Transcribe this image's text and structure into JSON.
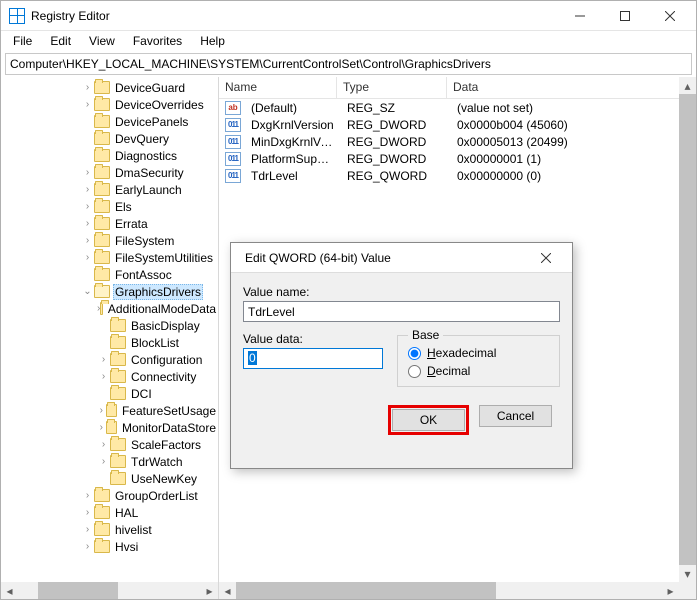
{
  "window": {
    "title": "Registry Editor"
  },
  "menu": {
    "file": "File",
    "edit": "Edit",
    "view": "View",
    "favorites": "Favorites",
    "help": "Help"
  },
  "address": "Computer\\HKEY_LOCAL_MACHINE\\SYSTEM\\CurrentControlSet\\Control\\GraphicsDrivers",
  "tree": [
    {
      "indent": 5,
      "tw": ">",
      "label": "DeviceGuard"
    },
    {
      "indent": 5,
      "tw": ">",
      "label": "DeviceOverrides"
    },
    {
      "indent": 5,
      "tw": "",
      "label": "DevicePanels"
    },
    {
      "indent": 5,
      "tw": "",
      "label": "DevQuery"
    },
    {
      "indent": 5,
      "tw": "",
      "label": "Diagnostics"
    },
    {
      "indent": 5,
      "tw": ">",
      "label": "DmaSecurity"
    },
    {
      "indent": 5,
      "tw": ">",
      "label": "EarlyLaunch"
    },
    {
      "indent": 5,
      "tw": ">",
      "label": "Els"
    },
    {
      "indent": 5,
      "tw": ">",
      "label": "Errata"
    },
    {
      "indent": 5,
      "tw": ">",
      "label": "FileSystem"
    },
    {
      "indent": 5,
      "tw": ">",
      "label": "FileSystemUtilities"
    },
    {
      "indent": 5,
      "tw": "",
      "label": "FontAssoc"
    },
    {
      "indent": 5,
      "tw": "v",
      "label": "GraphicsDrivers",
      "sel": true,
      "open": true
    },
    {
      "indent": 6,
      "tw": ">",
      "label": "AdditionalModeData"
    },
    {
      "indent": 6,
      "tw": "",
      "label": "BasicDisplay"
    },
    {
      "indent": 6,
      "tw": "",
      "label": "BlockList"
    },
    {
      "indent": 6,
      "tw": ">",
      "label": "Configuration"
    },
    {
      "indent": 6,
      "tw": ">",
      "label": "Connectivity"
    },
    {
      "indent": 6,
      "tw": "",
      "label": "DCI"
    },
    {
      "indent": 6,
      "tw": ">",
      "label": "FeatureSetUsage"
    },
    {
      "indent": 6,
      "tw": ">",
      "label": "MonitorDataStore"
    },
    {
      "indent": 6,
      "tw": ">",
      "label": "ScaleFactors"
    },
    {
      "indent": 6,
      "tw": ">",
      "label": "TdrWatch"
    },
    {
      "indent": 6,
      "tw": "",
      "label": "UseNewKey"
    },
    {
      "indent": 5,
      "tw": ">",
      "label": "GroupOrderList"
    },
    {
      "indent": 5,
      "tw": ">",
      "label": "HAL"
    },
    {
      "indent": 5,
      "tw": ">",
      "label": "hivelist"
    },
    {
      "indent": 5,
      "tw": ">",
      "label": "Hvsi"
    }
  ],
  "list": {
    "columns": {
      "name": "Name",
      "type": "Type",
      "data": "Data"
    },
    "rows": [
      {
        "icon": "str",
        "name": "(Default)",
        "type": "REG_SZ",
        "data": "(value not set)"
      },
      {
        "icon": "bin",
        "name": "DxgKrnlVersion",
        "type": "REG_DWORD",
        "data": "0x0000b004 (45060)"
      },
      {
        "icon": "bin",
        "name": "MinDxgKrnlVersi...",
        "type": "REG_DWORD",
        "data": "0x00005013 (20499)"
      },
      {
        "icon": "bin",
        "name": "PlatformSuppor...",
        "type": "REG_DWORD",
        "data": "0x00000001 (1)"
      },
      {
        "icon": "bin",
        "name": "TdrLevel",
        "type": "REG_QWORD",
        "data": "0x00000000 (0)"
      }
    ]
  },
  "dialog": {
    "title": "Edit QWORD (64-bit) Value",
    "value_name_label": "Value name:",
    "value_name": "TdrLevel",
    "value_data_label": "Value data:",
    "value_data": "0",
    "base_label": "Base",
    "hex_label_pre": "H",
    "hex_label_post": "exadecimal",
    "dec_label_pre": "D",
    "dec_label_post": "ecimal",
    "ok": "OK",
    "cancel": "Cancel"
  }
}
